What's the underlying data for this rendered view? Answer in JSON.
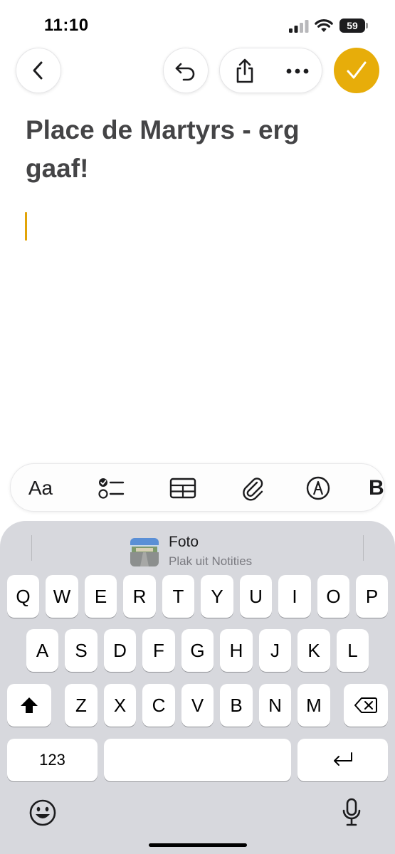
{
  "status_bar": {
    "time": "11:10",
    "battery": "59"
  },
  "toolbar": {
    "back_icon": "chevron-left-icon",
    "undo_icon": "undo-icon",
    "share_icon": "share-icon",
    "more_icon": "ellipsis-icon",
    "done_icon": "checkmark-icon",
    "accent_color": "#e7ad0a"
  },
  "note": {
    "title": "Place de Martyrs - erg gaaf!",
    "cursor_color": "#e2a408"
  },
  "format_bar": {
    "text_style_label": "Aa",
    "overflow_label": "B",
    "icons": [
      "checklist-icon",
      "table-icon",
      "attachment-icon",
      "markup-icon"
    ]
  },
  "suggestion": {
    "title": "Foto",
    "subtitle": "Plak uit Notities"
  },
  "keyboard": {
    "row1": [
      "Q",
      "W",
      "E",
      "R",
      "T",
      "Y",
      "U",
      "I",
      "O",
      "P"
    ],
    "row2": [
      "A",
      "S",
      "D",
      "F",
      "G",
      "H",
      "J",
      "K",
      "L"
    ],
    "row3": [
      "Z",
      "X",
      "C",
      "V",
      "B",
      "N",
      "M"
    ],
    "numbers_label": "123",
    "space_label": "",
    "shift_icon": "shift-icon",
    "delete_icon": "delete-icon",
    "return_icon": "return-icon",
    "emoji_icon": "emoji-icon",
    "mic_icon": "microphone-icon"
  }
}
